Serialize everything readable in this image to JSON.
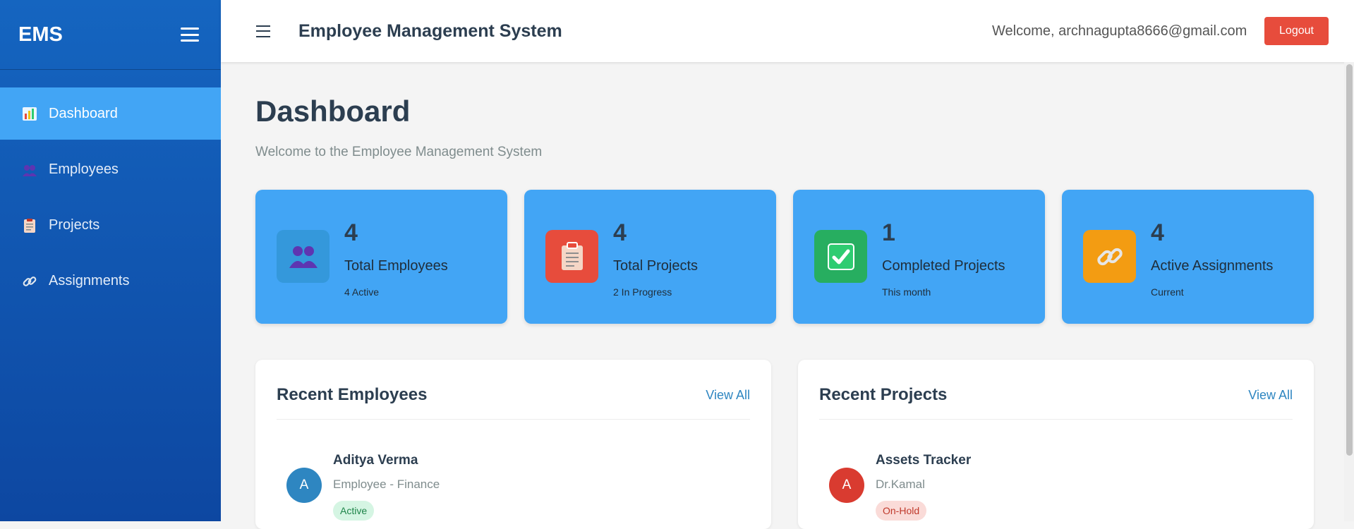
{
  "sidebar": {
    "brand": "EMS",
    "items": [
      {
        "label": "Dashboard",
        "icon": "chart-icon",
        "active": true
      },
      {
        "label": "Employees",
        "icon": "people-icon",
        "active": false
      },
      {
        "label": "Projects",
        "icon": "clipboard-icon",
        "active": false
      },
      {
        "label": "Assignments",
        "icon": "link-icon",
        "active": false
      }
    ]
  },
  "header": {
    "title": "Employee Management System",
    "welcome": "Welcome, archnagupta8666@gmail.com",
    "logout_label": "Logout"
  },
  "main": {
    "title": "Dashboard",
    "subtitle": "Welcome to the Employee Management System",
    "stats": [
      {
        "value": "4",
        "label": "Total Employees",
        "sub": "4 Active",
        "icon": "people-icon",
        "icon_color": "#3498db"
      },
      {
        "value": "4",
        "label": "Total Projects",
        "sub": "2 In Progress",
        "icon": "clipboard-icon",
        "icon_color": "#e74c3c"
      },
      {
        "value": "1",
        "label": "Completed Projects",
        "sub": "This month",
        "icon": "check-icon",
        "icon_color": "#27ae60"
      },
      {
        "value": "4",
        "label": "Active Assignments",
        "sub": "Current",
        "icon": "link-icon",
        "icon_color": "#f39c12"
      }
    ],
    "recent_employees": {
      "title": "Recent Employees",
      "view_all": "View All",
      "items": [
        {
          "initial": "A",
          "name": "Aditya Verma",
          "sub": "Employee - Finance",
          "status": "Active",
          "avatar_color": "#2e86c1"
        }
      ]
    },
    "recent_projects": {
      "title": "Recent Projects",
      "view_all": "View All",
      "items": [
        {
          "initial": "A",
          "name": "Assets Tracker",
          "sub": "Dr.Kamal",
          "status": "On-Hold",
          "avatar_color": "#d93b30"
        }
      ]
    }
  },
  "colors": {
    "sidebar": "#1565c0",
    "active_nav": "#42a5f5",
    "card": "#42a5f5",
    "logout": "#e74c3c",
    "active_badge_bg": "#d5f5e3",
    "active_badge_text": "#1e8449",
    "onhold_badge_bg": "#fadbd8",
    "onhold_badge_text": "#c0392b"
  }
}
